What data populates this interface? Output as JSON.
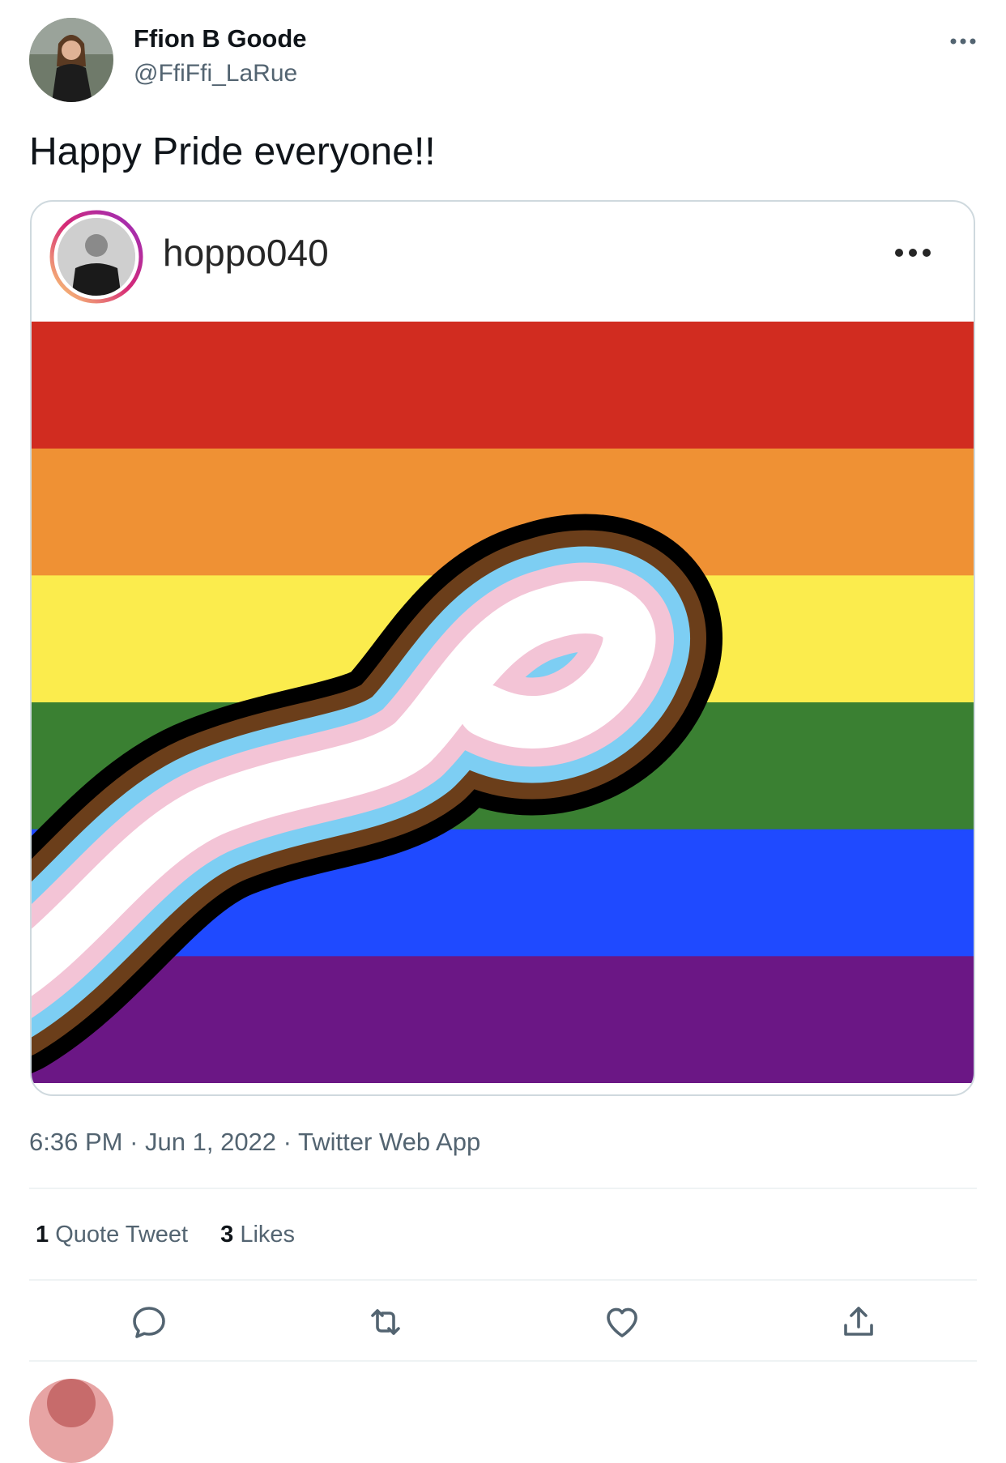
{
  "tweet": {
    "author_name": "Ffion B Goode",
    "author_handle": "@FfiFfi_LaRue",
    "more_icon": "more-horizontal-icon",
    "text": "Happy Pride everyone!!",
    "time": "6:36 PM",
    "separator": " · ",
    "date": "Jun 1, 2022",
    "source": "Twitter Web App"
  },
  "embedded_post": {
    "username": "hoppo040",
    "more_icon": "more-horizontal-icon",
    "flag_colors": [
      "#d12c20",
      "#ef9134",
      "#fbec4d",
      "#3a8032",
      "#1f4aff",
      "#6b1785"
    ],
    "arm_colors": [
      "#000000",
      "#6b3e1a",
      "#7dcef3",
      "#f3c4d6",
      "#ffffff"
    ]
  },
  "stats": {
    "quote_count": "1",
    "quote_label": "Quote Tweet",
    "like_count": "3",
    "like_label": "Likes"
  },
  "actions": [
    {
      "icon": "reply-icon"
    },
    {
      "icon": "retweet-icon"
    },
    {
      "icon": "like-icon"
    },
    {
      "icon": "share-icon"
    }
  ],
  "colors": {
    "secondary_text": "#536471",
    "primary_text": "#0f1419",
    "divider": "#eff3f4"
  }
}
